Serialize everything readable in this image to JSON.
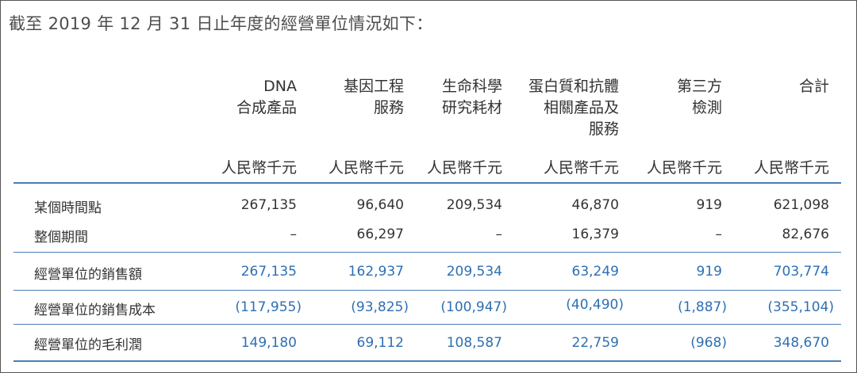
{
  "heading": "截至 2019 年 12 月 31 日止年度的經營單位情況如下：",
  "columns": [
    {
      "lines": [
        "DNA",
        "合成產品"
      ],
      "unit": "人民幣千元"
    },
    {
      "lines": [
        "基因工程",
        "服務"
      ],
      "unit": "人民幣千元"
    },
    {
      "lines": [
        "生命科學",
        "研究耗材"
      ],
      "unit": "人民幣千元"
    },
    {
      "lines": [
        "蛋白質和抗體",
        "相關產品及",
        "服務"
      ],
      "unit": "人民幣千元"
    },
    {
      "lines": [
        "第三方",
        "檢測"
      ],
      "unit": "人民幣千元"
    },
    {
      "lines": [
        "合計"
      ],
      "unit": "人民幣千元"
    }
  ],
  "rows": [
    {
      "label": "某個時間點",
      "values": [
        "267,135",
        "96,640",
        "209,534",
        "46,870",
        "919",
        "621,098"
      ]
    },
    {
      "label": "整個期間",
      "values": [
        "–",
        "66,297",
        "–",
        "16,379",
        "–",
        "82,676"
      ]
    },
    {
      "label": "經營單位的銷售額",
      "values": [
        "267,135",
        "162,937",
        "209,534",
        "63,249",
        "919",
        "703,774"
      ]
    },
    {
      "label": "經營單位的銷售成本",
      "values": [
        "(117,955)",
        "(93,825)",
        "(100,947)",
        "(40,490)",
        "(1,887)",
        "(355,104)"
      ]
    },
    {
      "label": "經營單位的毛利潤",
      "values": [
        "149,180",
        "69,112",
        "108,587",
        "22,759",
        "(968)",
        "348,670"
      ]
    }
  ],
  "colors": {
    "rule": "#4a7fb5",
    "figure_blue": "#2e6fb3",
    "text": "#333333"
  }
}
